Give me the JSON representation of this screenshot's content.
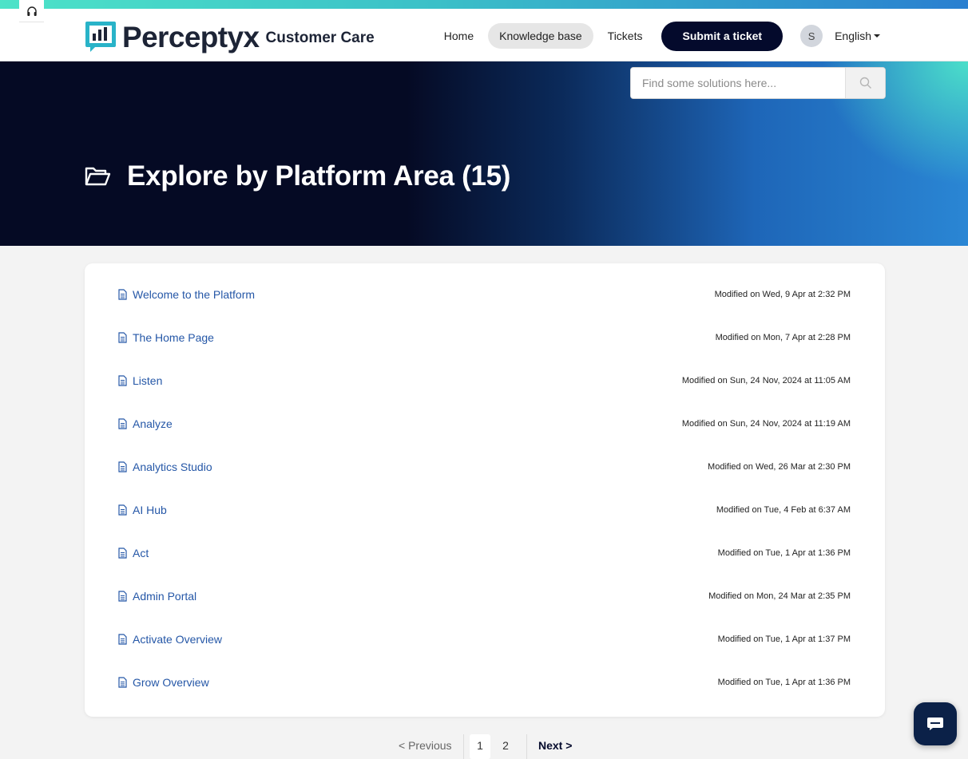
{
  "brand": {
    "name": "Perceptyx",
    "subtitle": "Customer Care",
    "logo_icon": "chart-bubble-logo-icon",
    "accent": "#29b3c8"
  },
  "nav": {
    "home": "Home",
    "knowledge_base": "Knowledge base",
    "tickets": "Tickets",
    "submit_ticket": "Submit a ticket",
    "avatar_initial": "S",
    "language": "English"
  },
  "search": {
    "placeholder": "Find some solutions here..."
  },
  "hero": {
    "title": "Explore by Platform Area (15)",
    "icon": "folder-open-icon"
  },
  "articles": [
    {
      "title": "Welcome to the Platform",
      "modified": "Modified on Wed, 9 Apr at 2:32 PM"
    },
    {
      "title": "The Home Page",
      "modified": "Modified on Mon, 7 Apr at 2:28 PM"
    },
    {
      "title": "Listen",
      "modified": "Modified on Sun, 24 Nov, 2024 at 11:05 AM"
    },
    {
      "title": "Analyze",
      "modified": "Modified on Sun, 24 Nov, 2024 at 11:19 AM"
    },
    {
      "title": "Analytics Studio",
      "modified": "Modified on Wed, 26 Mar at 2:30 PM"
    },
    {
      "title": "AI Hub",
      "modified": "Modified on Tue, 4 Feb at 6:37 AM"
    },
    {
      "title": "Act",
      "modified": "Modified on Tue, 1 Apr at 1:36 PM"
    },
    {
      "title": "Admin Portal",
      "modified": "Modified on Mon, 24 Mar at 2:35 PM"
    },
    {
      "title": "Activate Overview",
      "modified": "Modified on Tue, 1 Apr at 1:37 PM"
    },
    {
      "title": "Grow Overview",
      "modified": "Modified on Tue, 1 Apr at 1:36 PM"
    }
  ],
  "pagination": {
    "previous": "< Previous",
    "pages": [
      "1",
      "2"
    ],
    "current": "1",
    "next": "Next >"
  },
  "colors": {
    "link": "#2557a7",
    "primary_button": "#040a2c",
    "hero_dark": "#050a24",
    "hero_blue": "#2a86d4"
  }
}
